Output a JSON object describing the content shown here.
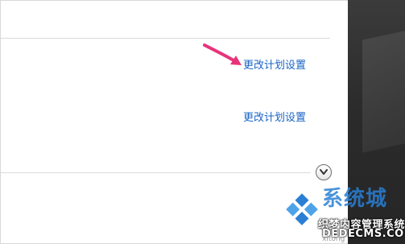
{
  "plan_links": [
    {
      "label": "更改计划设置"
    },
    {
      "label": "更改计划设置"
    }
  ],
  "colors": {
    "link": "#1a64c4",
    "arrow": "#e8337a",
    "divider": "#dadada",
    "side_panel": "#2b2b2b",
    "watermark_blue": "#2a7fd4"
  },
  "icons": {
    "expand": "chevron-down-icon",
    "annotation": "arrow-pointer-icon"
  },
  "watermark": {
    "title": "系统城",
    "site_name": "织梦内容管理系统",
    "domain": "DEDECMS.COM",
    "sub": "xitong"
  }
}
